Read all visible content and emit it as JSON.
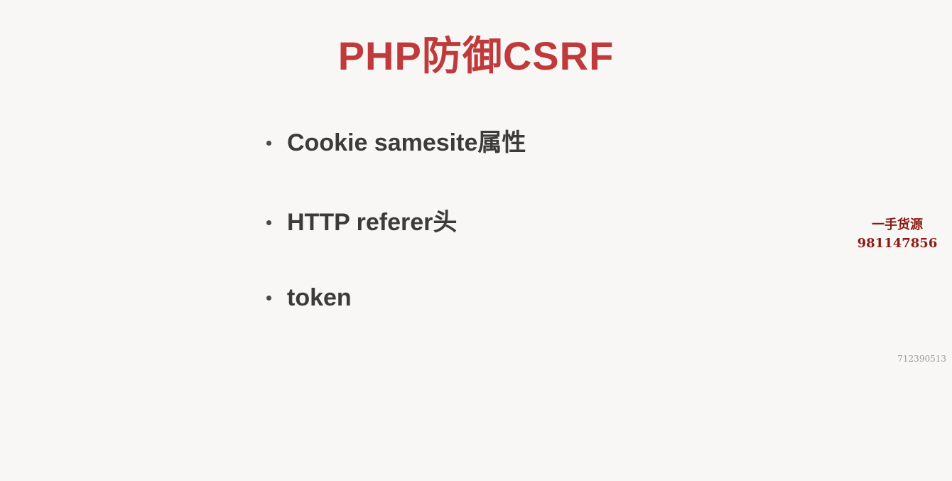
{
  "slide": {
    "title": "PHP防御CSRF",
    "title_color": "#c03a3b",
    "bullets": [
      {
        "text": "Cookie samesite属性"
      },
      {
        "text": "HTTP referer头"
      },
      {
        "text": "token"
      }
    ]
  },
  "watermark": {
    "line1": "一手货源",
    "line2": "981147856",
    "color": "#8b1a12",
    "corner_number": "712390513",
    "corner_color": "#9a9a9a"
  }
}
